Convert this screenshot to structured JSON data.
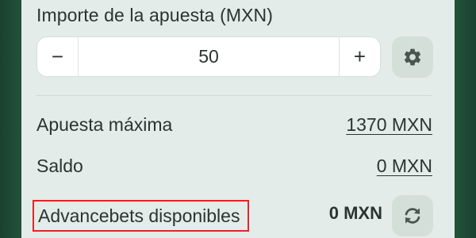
{
  "bet": {
    "label": "Importe de la apuesta (MXN)",
    "value": "50",
    "decrement_symbol": "−",
    "increment_symbol": "+"
  },
  "settings": {
    "icon": "gear-icon"
  },
  "max_bet": {
    "label": "Apuesta máxima",
    "value": "1370 MXN"
  },
  "balance": {
    "label": "Saldo",
    "value": "0 MXN"
  },
  "advancebets": {
    "label": "Advancebets disponibles",
    "value": "0 MXN",
    "icon": "refresh-icon"
  },
  "colors": {
    "panel_background": "#e3ece8",
    "frame_green": "#1f4a33",
    "button_background": "#d4dfda",
    "highlight_border": "#e0262b",
    "text": "#2c3431"
  }
}
